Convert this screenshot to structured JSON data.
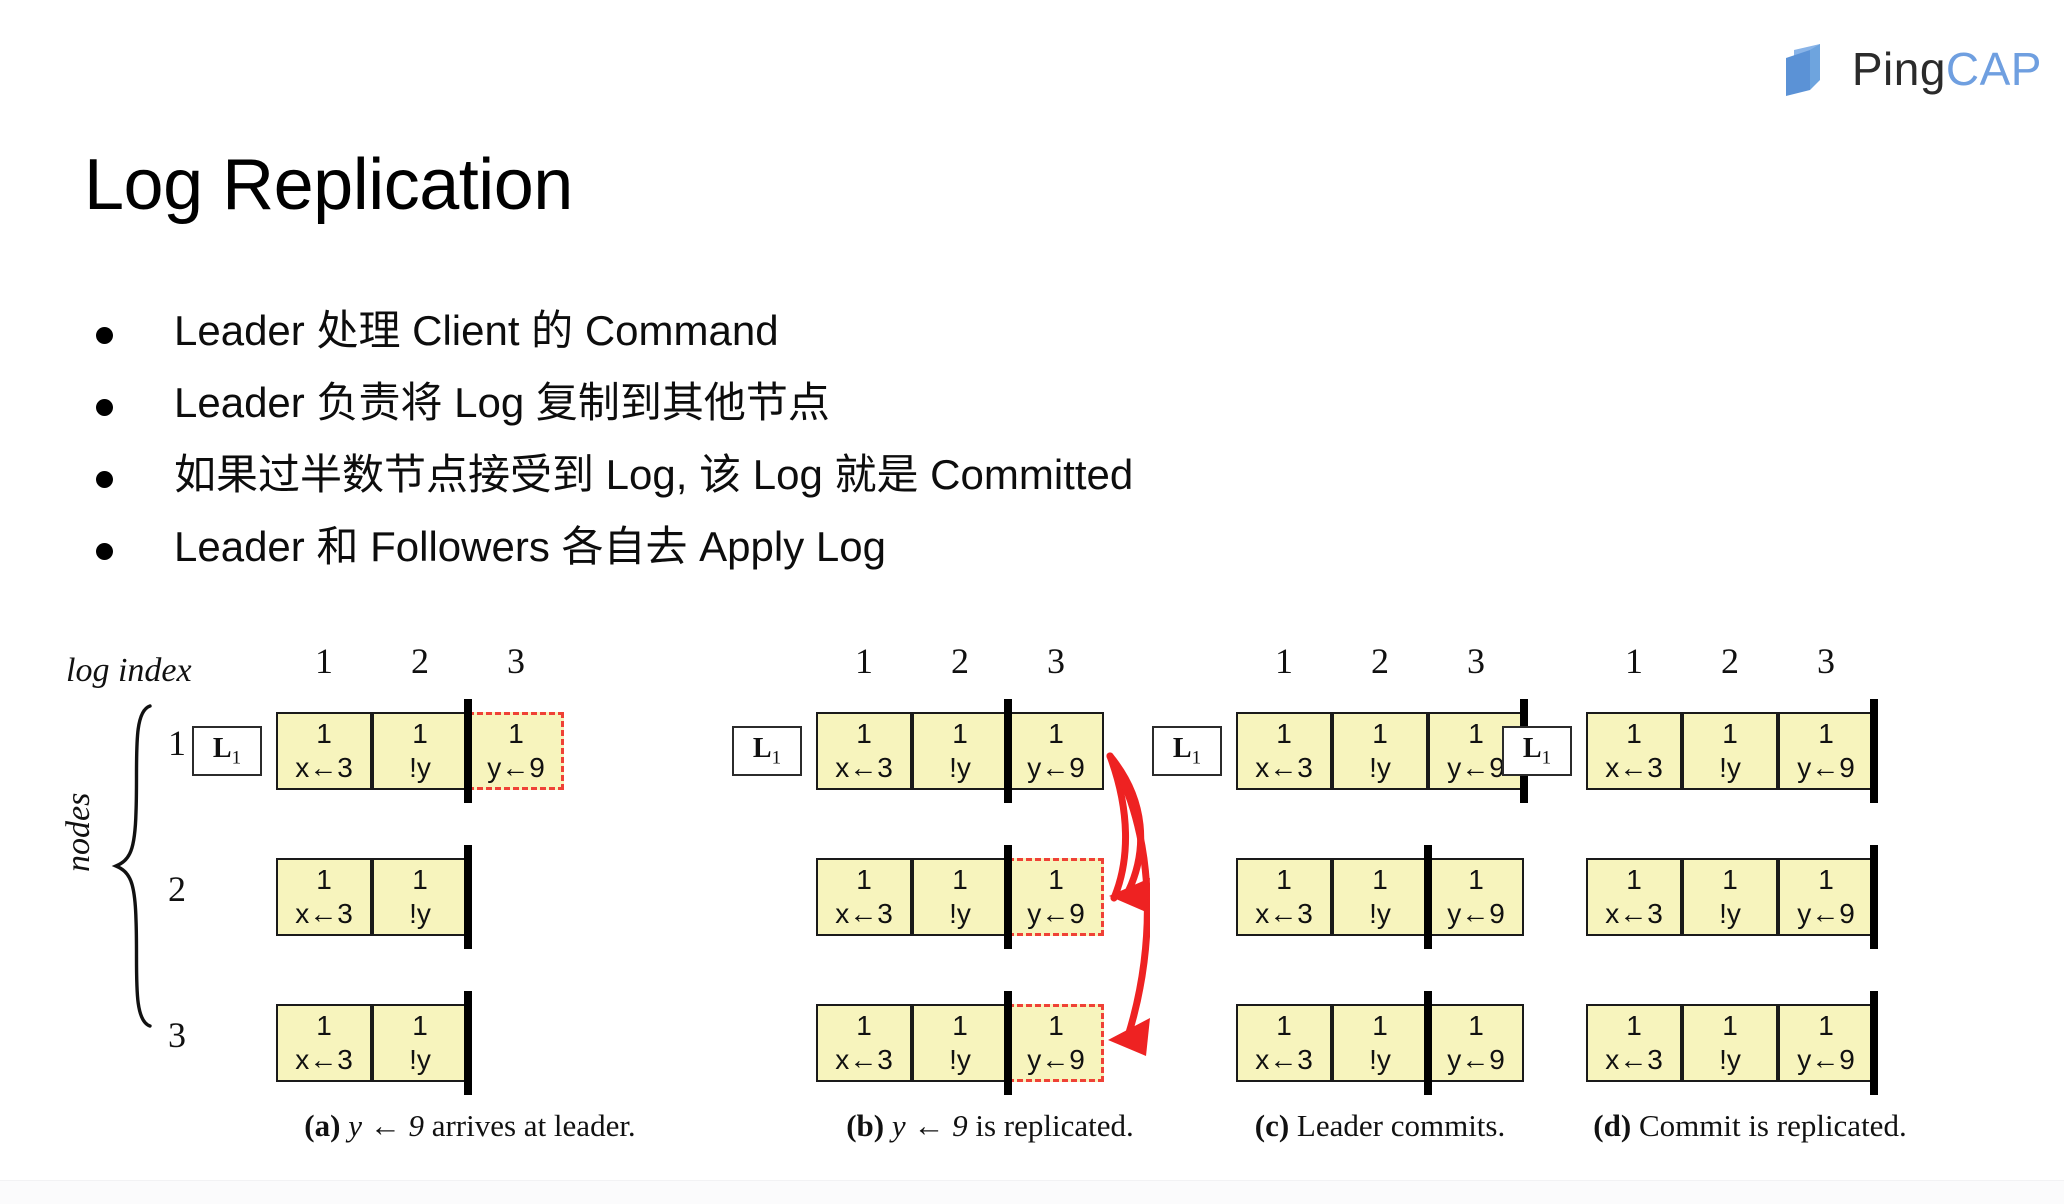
{
  "brand": {
    "logo_ping": "Ping",
    "logo_cap": "CAP",
    "logo_mark_icon": "pingcap-logo-icon",
    "dark_color": "#2b2b2b",
    "accent_color": "#6f9fe0"
  },
  "slide": {
    "title": "Log Replication",
    "bullets": [
      "Leader 处理 Client 的 Command",
      "Leader 负责将 Log 复制到其他节点",
      "如果过半数节点接受到 Log, 该 Log 就是 Committed",
      "Leader 和 Followers 各自去 Apply Log"
    ]
  },
  "figure": {
    "axis_label": "log index",
    "nodes_label": "nodes",
    "node_numbers": [
      "1",
      "2",
      "3"
    ],
    "log_indices": [
      "1",
      "2",
      "3"
    ],
    "leader_label": "L",
    "leader_sub": "1",
    "cell_fill_color": "#f7f4bd",
    "cell_border_color": "#1a1a1a",
    "pending_border_color": "#ef4136",
    "commit_bar_color": "#000000",
    "arrow_color": "#ee2222",
    "panels": [
      {
        "id": "a",
        "caption_prefix": "(a)",
        "caption_math": "y ← 9",
        "caption_text": "arrives at leader.",
        "rows": [
          {
            "leader": true,
            "cells": [
              {
                "term": "1",
                "cmd": "x←3",
                "state": "committed"
              },
              {
                "term": "1",
                "cmd": "!y",
                "state": "committed"
              },
              {
                "term": "1",
                "cmd": "y←9",
                "state": "pending"
              }
            ],
            "commit_after": 2
          },
          {
            "leader": false,
            "cells": [
              {
                "term": "1",
                "cmd": "x←3",
                "state": "committed"
              },
              {
                "term": "1",
                "cmd": "!y",
                "state": "committed"
              }
            ],
            "commit_after": 2
          },
          {
            "leader": false,
            "cells": [
              {
                "term": "1",
                "cmd": "x←3",
                "state": "committed"
              },
              {
                "term": "1",
                "cmd": "!y",
                "state": "committed"
              }
            ],
            "commit_after": 2
          }
        ],
        "arrow": false
      },
      {
        "id": "b",
        "caption_prefix": "(b)",
        "caption_math": "y ← 9",
        "caption_text": "is replicated.",
        "rows": [
          {
            "leader": true,
            "cells": [
              {
                "term": "1",
                "cmd": "x←3",
                "state": "committed"
              },
              {
                "term": "1",
                "cmd": "!y",
                "state": "committed"
              },
              {
                "term": "1",
                "cmd": "y←9",
                "state": "committed"
              }
            ],
            "commit_after": 2
          },
          {
            "leader": false,
            "cells": [
              {
                "term": "1",
                "cmd": "x←3",
                "state": "committed"
              },
              {
                "term": "1",
                "cmd": "!y",
                "state": "committed"
              },
              {
                "term": "1",
                "cmd": "y←9",
                "state": "pending"
              }
            ],
            "commit_after": 2
          },
          {
            "leader": false,
            "cells": [
              {
                "term": "1",
                "cmd": "x←3",
                "state": "committed"
              },
              {
                "term": "1",
                "cmd": "!y",
                "state": "committed"
              },
              {
                "term": "1",
                "cmd": "y←9",
                "state": "pending"
              }
            ],
            "commit_after": 2
          }
        ],
        "arrow": true
      },
      {
        "id": "c",
        "caption_prefix": "(c)",
        "caption_math": "",
        "caption_text": "Leader commits.",
        "rows": [
          {
            "leader": true,
            "cells": [
              {
                "term": "1",
                "cmd": "x←3",
                "state": "committed"
              },
              {
                "term": "1",
                "cmd": "!y",
                "state": "committed"
              },
              {
                "term": "1",
                "cmd": "y←9",
                "state": "committed"
              }
            ],
            "commit_after": 3
          },
          {
            "leader": false,
            "cells": [
              {
                "term": "1",
                "cmd": "x←3",
                "state": "committed"
              },
              {
                "term": "1",
                "cmd": "!y",
                "state": "committed"
              },
              {
                "term": "1",
                "cmd": "y←9",
                "state": "committed"
              }
            ],
            "commit_after": 2
          },
          {
            "leader": false,
            "cells": [
              {
                "term": "1",
                "cmd": "x←3",
                "state": "committed"
              },
              {
                "term": "1",
                "cmd": "!y",
                "state": "committed"
              },
              {
                "term": "1",
                "cmd": "y←9",
                "state": "committed"
              }
            ],
            "commit_after": 2
          }
        ],
        "arrow": false
      },
      {
        "id": "d",
        "caption_prefix": "(d)",
        "caption_math": "",
        "caption_text": "Commit is replicated.",
        "rows": [
          {
            "leader": true,
            "cells": [
              {
                "term": "1",
                "cmd": "x←3",
                "state": "committed"
              },
              {
                "term": "1",
                "cmd": "!y",
                "state": "committed"
              },
              {
                "term": "1",
                "cmd": "y←9",
                "state": "committed"
              }
            ],
            "commit_after": 3
          },
          {
            "leader": false,
            "cells": [
              {
                "term": "1",
                "cmd": "x←3",
                "state": "committed"
              },
              {
                "term": "1",
                "cmd": "!y",
                "state": "committed"
              },
              {
                "term": "1",
                "cmd": "y←9",
                "state": "committed"
              }
            ],
            "commit_after": 3
          },
          {
            "leader": false,
            "cells": [
              {
                "term": "1",
                "cmd": "x←3",
                "state": "committed"
              },
              {
                "term": "1",
                "cmd": "!y",
                "state": "committed"
              },
              {
                "term": "1",
                "cmd": "y←9",
                "state": "committed"
              }
            ],
            "commit_after": 3
          }
        ],
        "arrow": false
      }
    ]
  }
}
